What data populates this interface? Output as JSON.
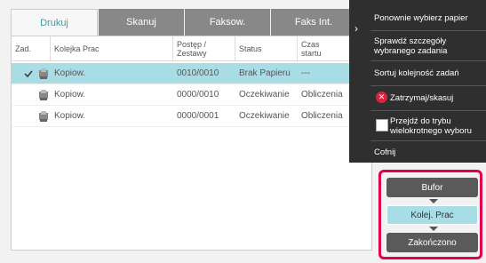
{
  "tabs": [
    "Drukuj",
    "Skanuj",
    "Faksow.",
    "Faks Int."
  ],
  "table": {
    "headers": {
      "zad": "Zad.",
      "kolejka": "Kolejka Prac",
      "postep": "Postęp / Zestawy",
      "status": "Status",
      "czas": "Czas startu"
    },
    "rows": [
      {
        "name": "Kopiow.",
        "progress": "0010/0010",
        "status": "Brak Papieru",
        "time": "---",
        "selected": true
      },
      {
        "name": "Kopiow.",
        "progress": "0000/0010",
        "status": "Oczekiwanie",
        "time": "Obliczenia",
        "selected": false
      },
      {
        "name": "Kopiow.",
        "progress": "0000/0001",
        "status": "Oczekiwanie",
        "time": "Obliczenia",
        "selected": false
      }
    ]
  },
  "menu": {
    "items": [
      "Ponownie wybierz papier",
      "Sprawdź szczegóły wybranego zadania",
      "Sortuj kolejność zadań",
      "Zatrzymaj/skasuj",
      "Przejdź do trybu wielokrotnego wyboru",
      "Cofnij"
    ]
  },
  "buttons": {
    "bufor": "Bufor",
    "kolej": "Kolej. Prac",
    "zakonczono": "Zakończono"
  }
}
